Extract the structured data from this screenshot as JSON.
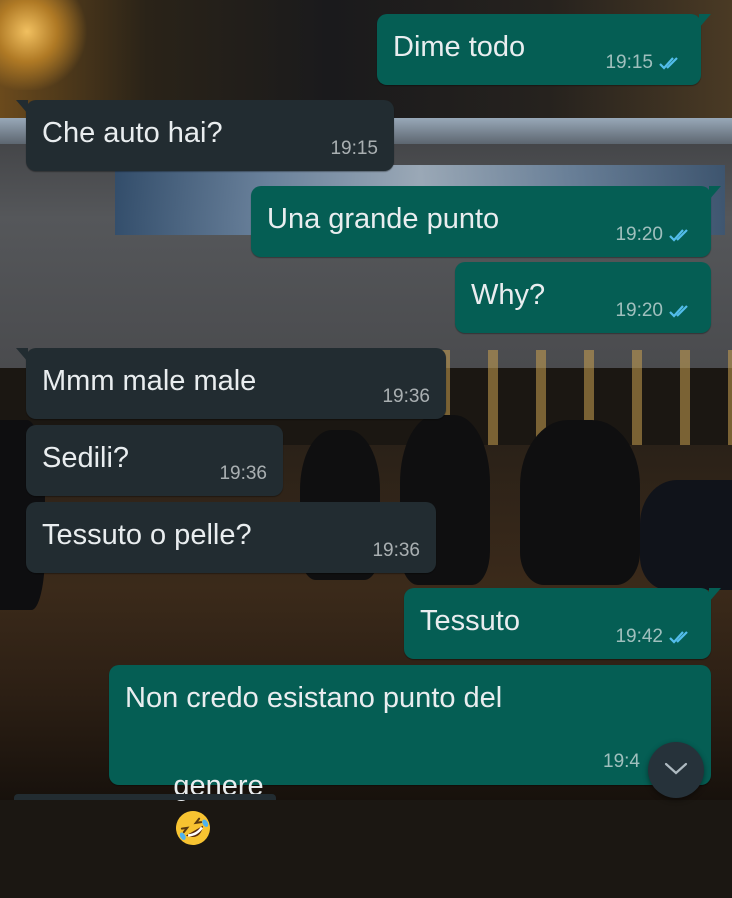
{
  "colors": {
    "incoming_bubble": "#222c31",
    "outgoing_bubble": "#055e54",
    "read_ticks": "#53bdeb",
    "text": "#e9edef"
  },
  "messages": [
    {
      "direction": "out",
      "text": "Dime todo",
      "time": "19:15",
      "status": "read"
    },
    {
      "direction": "in",
      "text": "Che auto hai?",
      "time": "19:15"
    },
    {
      "direction": "out",
      "text": "Una grande punto",
      "time": "19:20",
      "status": "read"
    },
    {
      "direction": "out",
      "text": "Why?",
      "time": "19:20",
      "status": "read"
    },
    {
      "direction": "in",
      "text": "Mmm male male",
      "time": "19:36"
    },
    {
      "direction": "in",
      "text": "Sedili?",
      "time": "19:36"
    },
    {
      "direction": "in",
      "text": "Tessuto o pelle?",
      "time": "19:36"
    },
    {
      "direction": "out",
      "text": "Tessuto",
      "time": "19:42",
      "status": "read"
    },
    {
      "direction": "out",
      "text_line1": "Non credo esistano punto del",
      "text_line2": "genere",
      "emoji": "rolling-on-the-floor-laughing",
      "time": "19:4"
    }
  ],
  "scroll_button": {
    "icon": "chevron-down-icon"
  },
  "background": "night-street-wallpaper"
}
